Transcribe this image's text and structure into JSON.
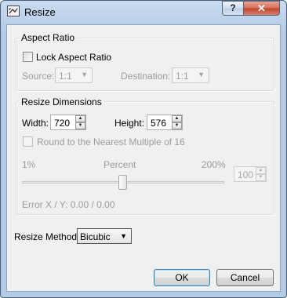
{
  "window": {
    "title": "Resize",
    "help_label": "?",
    "close_label": "✕"
  },
  "aspect_ratio": {
    "group_title": "Aspect Ratio",
    "lock_label": "Lock Aspect Ratio",
    "lock_checked": false,
    "source_label": "Source:",
    "source_value": "1:1",
    "destination_label": "Destination:",
    "destination_value": "1:1"
  },
  "resize_dimensions": {
    "group_title": "Resize Dimensions",
    "width_label": "Width:",
    "width_value": "720",
    "height_label": "Height:",
    "height_value": "576",
    "round_label": "Round to the Nearest Multiple of 16",
    "round_checked": false,
    "min_label": "1%",
    "mid_label": "Percent",
    "max_label": "200%",
    "percent_value": "100",
    "slider_percent": 100,
    "error_text": "Error X / Y:  0.00 / 0.00"
  },
  "resize_method": {
    "label": "Resize Method:",
    "value": "Bicubic"
  },
  "buttons": {
    "ok": "OK",
    "cancel": "Cancel"
  },
  "icons": {
    "app": "resize-app-icon",
    "help": "help-icon",
    "close": "close-icon",
    "combo_arrow": "▼",
    "spin_up": "▲",
    "spin_down": "▼"
  },
  "colors": {
    "title_bar": "#b4cbe6",
    "close_button": "#c0412a",
    "dialog_bg": "#f0f0f0",
    "default_button_border": "#3c7fb1"
  }
}
